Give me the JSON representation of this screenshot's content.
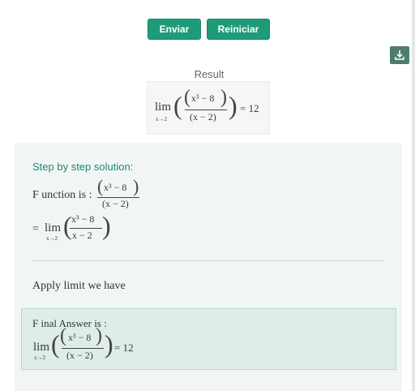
{
  "buttons": {
    "send_label": "Enviar",
    "reset_label": "Reiniciar"
  },
  "toolbar": {
    "download_icon": "download-icon"
  },
  "result": {
    "label": "Result",
    "lim_word": "lim",
    "lim_sub": "x→2",
    "numerator": "x³ − 8",
    "denominator": "x − 2",
    "equals_value": "= 12"
  },
  "steps": {
    "title": "Step by step solution:",
    "function_label": "F unction is :",
    "function_numerator": "x³ − 8",
    "function_denominator": "x − 2",
    "equals_lim": "=",
    "lim_word": "lim",
    "lim_sub": "x→2",
    "step2_numerator": "x³ − 8",
    "step2_denominator": "x − 2",
    "apply_text": "Apply limit we have"
  },
  "final": {
    "title": "F inal Answer is :",
    "lim_word": "lim",
    "lim_sub": "x→2",
    "numerator": "x³ − 8",
    "denominator": "x − 2",
    "equals_value": "= 12"
  },
  "colors": {
    "accent": "#1e9b7b",
    "step_title": "#1e8a6d",
    "final_bg": "#deeee6",
    "panel_bg": "#f2f5f5"
  }
}
